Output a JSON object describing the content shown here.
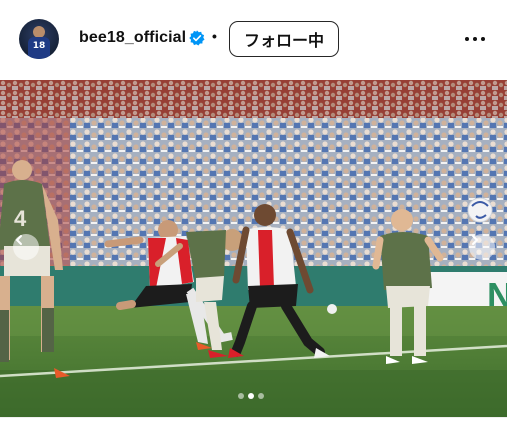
{
  "post": {
    "username": "bee18_official",
    "verified": true,
    "separator": "•",
    "follow_label": "フォロー中",
    "avatar_number": "18"
  },
  "carousel": {
    "total": 3,
    "active_index": 1
  },
  "photo": {
    "jersey_numbers": [
      "4"
    ],
    "board_text": "N"
  },
  "icons": {
    "verified": "verified-badge-icon",
    "more": "more-options-icon",
    "prev": "chevron-left-icon",
    "next": "chevron-right-icon"
  },
  "colors": {
    "verified_blue": "#0095f6",
    "pitch_green": "#4f7a3a",
    "home_red": "#d9202a",
    "away_green": "#5d7249"
  }
}
